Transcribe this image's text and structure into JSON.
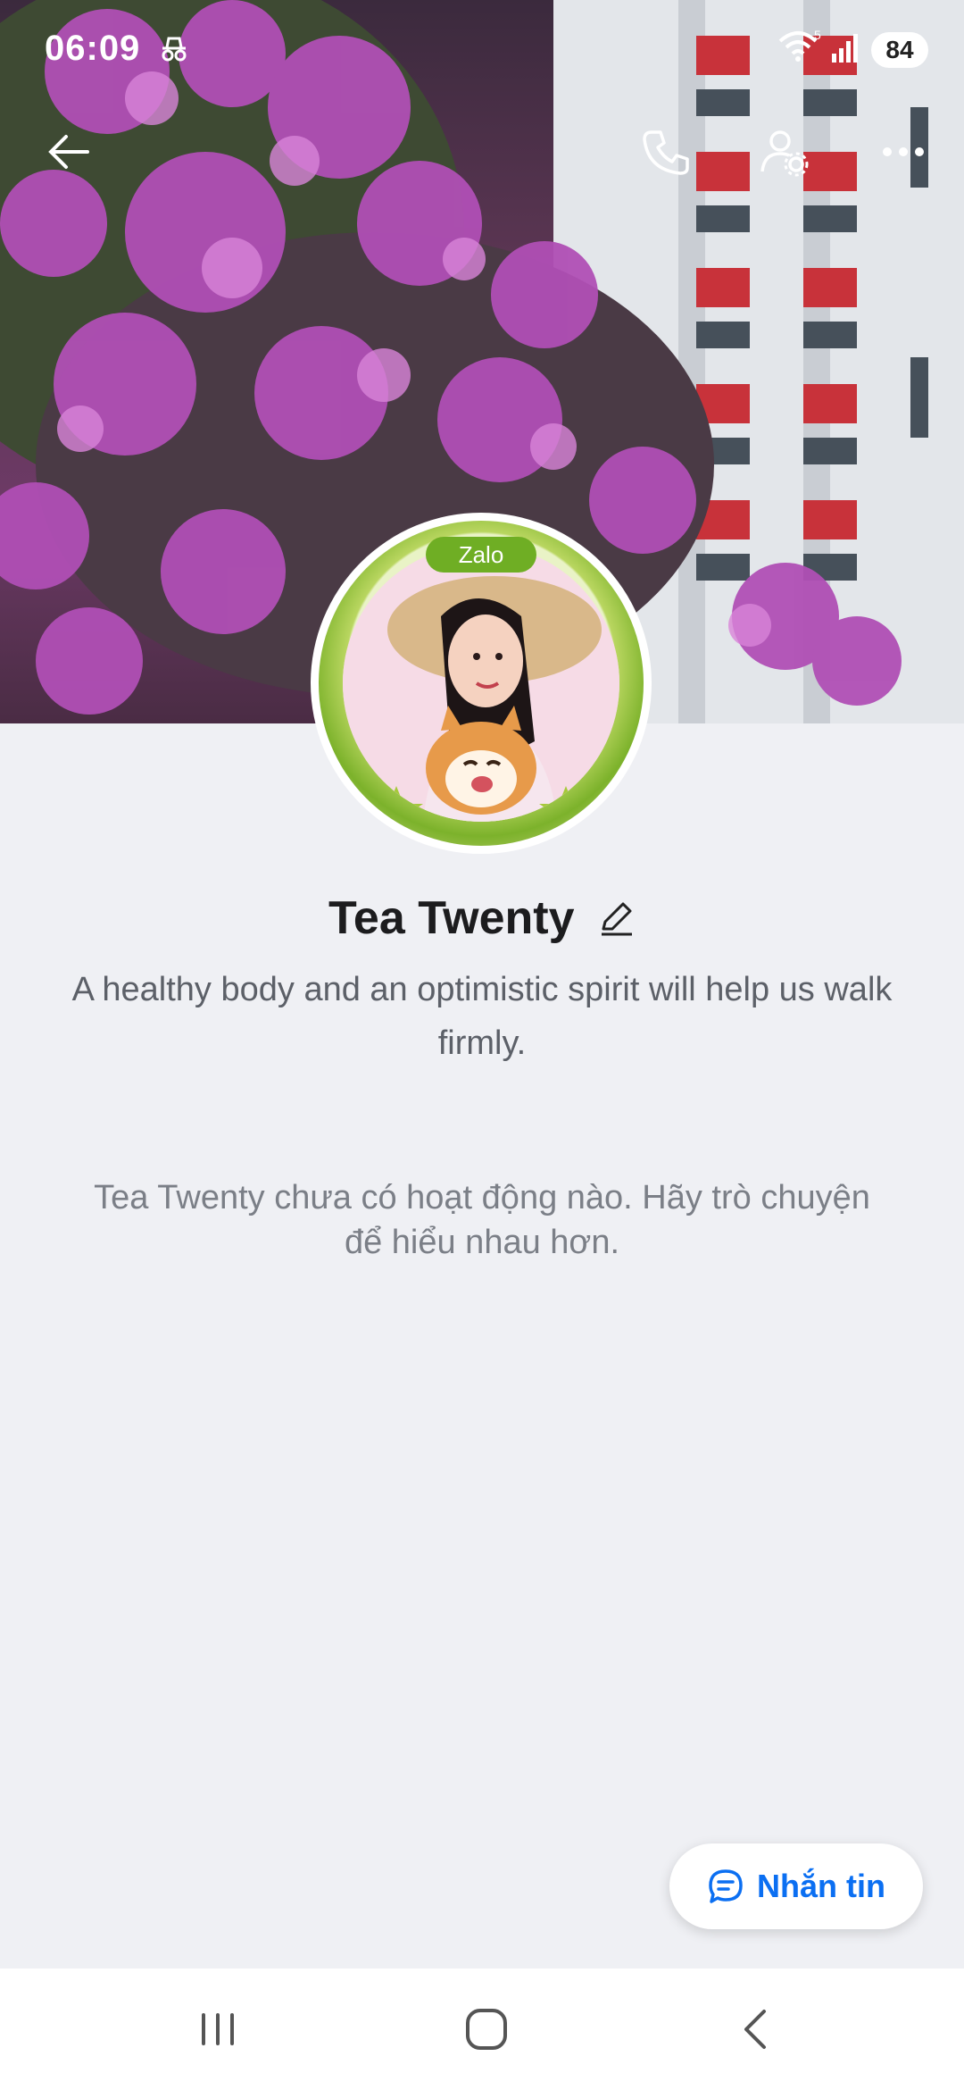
{
  "status_bar": {
    "time": "06:09",
    "battery": "84",
    "wifi_badge": "5",
    "icons": [
      "incognito-icon",
      "wifi-icon",
      "signal-icon",
      "battery-icon"
    ]
  },
  "top_actions": {
    "icons": [
      "back-arrow-icon",
      "phone-icon",
      "user-settings-icon",
      "more-icon"
    ]
  },
  "profile": {
    "brand_badge": "Zalo",
    "name": "Tea Twenty",
    "bio": "A healthy body and an optimistic spirit will help us walk firmly.",
    "empty_activity": "Tea Twenty chưa có hoạt động nào. Hãy trò chuyện để hiểu nhau hơn."
  },
  "message_button": {
    "label": "Nhắn tin",
    "icon": "chat-bubble-icon"
  },
  "nav_bar": {
    "icons": [
      "recents-icon",
      "home-icon",
      "back-icon"
    ]
  },
  "colors": {
    "accent": "#0b6ff2",
    "background": "#eff0f4",
    "zalo_green": "#6fae24"
  }
}
